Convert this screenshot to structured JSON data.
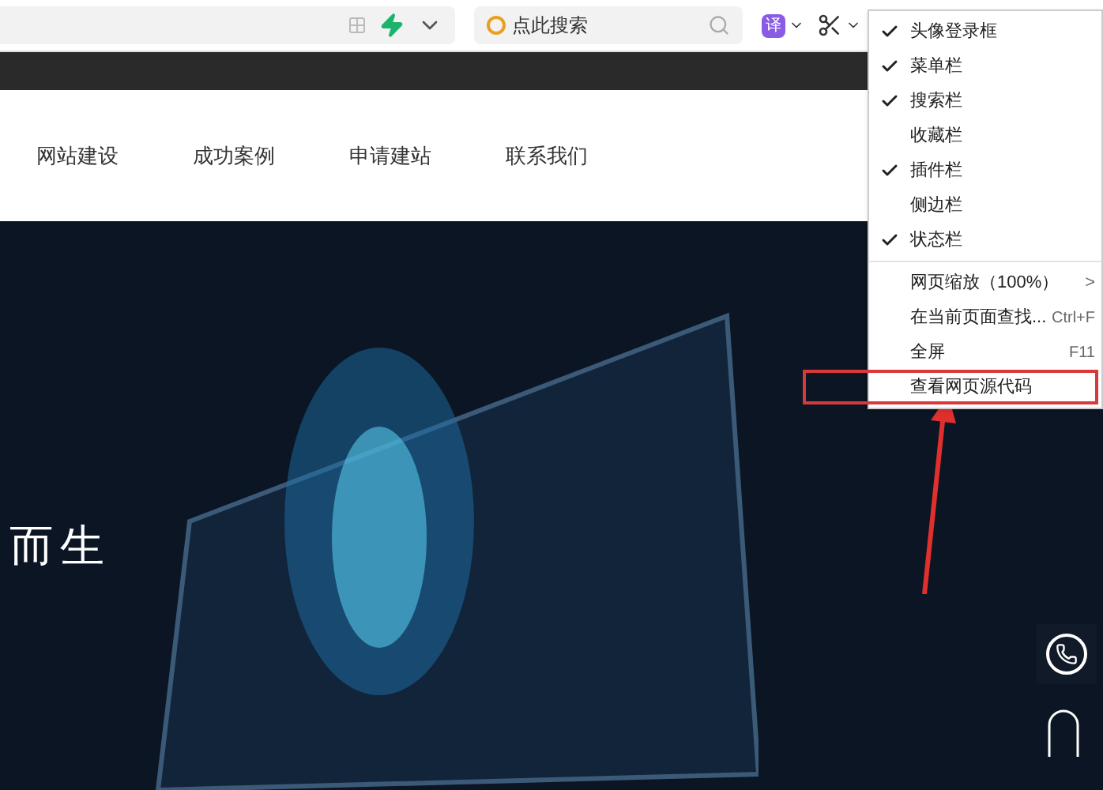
{
  "toolbar": {
    "search": {
      "placeholder": "点此搜索"
    },
    "translate_label": "译"
  },
  "nav": {
    "items": [
      {
        "label": "网站建设"
      },
      {
        "label": "成功案例"
      },
      {
        "label": "申请建站"
      },
      {
        "label": "联系我们"
      }
    ]
  },
  "hero": {
    "headline": "而生"
  },
  "menu": {
    "items": [
      {
        "kind": "toggle",
        "label": "头像登录框",
        "checked": true
      },
      {
        "kind": "toggle",
        "label": "菜单栏",
        "checked": true
      },
      {
        "kind": "toggle",
        "label": "搜索栏",
        "checked": true
      },
      {
        "kind": "toggle",
        "label": "收藏栏",
        "checked": false
      },
      {
        "kind": "toggle",
        "label": "插件栏",
        "checked": true
      },
      {
        "kind": "toggle",
        "label": "侧边栏",
        "checked": false
      },
      {
        "kind": "toggle",
        "label": "状态栏",
        "checked": true
      },
      {
        "kind": "submenu",
        "label": "网页缩放（100%）",
        "arrow": ">"
      },
      {
        "kind": "command",
        "label": "在当前页面查找...",
        "shortcut": "Ctrl+F"
      },
      {
        "kind": "command",
        "label": "全屏",
        "shortcut": "F11"
      },
      {
        "kind": "command",
        "label": "查看网页源代码",
        "highlighted": true
      }
    ]
  }
}
